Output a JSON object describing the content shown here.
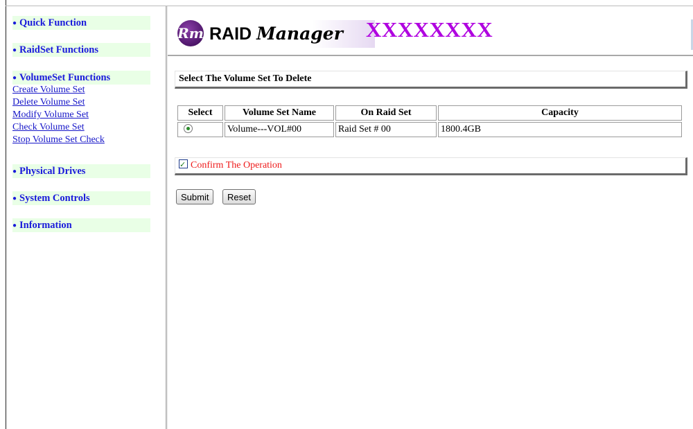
{
  "nav": {
    "sections": [
      {
        "label": "Quick Function"
      },
      {
        "label": "RaidSet Functions"
      },
      {
        "label": "VolumeSet Functions"
      },
      {
        "label": "Physical Drives"
      },
      {
        "label": "System Controls"
      },
      {
        "label": "Information"
      }
    ],
    "volumeset_links": [
      "Create Volume Set",
      "Delete Volume Set",
      "Modify Volume Set",
      "Check Volume Set",
      "Stop Volume Set Check"
    ]
  },
  "header": {
    "logo_mark": "Rm",
    "logo_word1": "RAID",
    "logo_word2": "Manager",
    "product_name": "XXXXXXXX"
  },
  "main": {
    "section_title": "Select The Volume Set To Delete",
    "table": {
      "columns": [
        "Select",
        "Volume Set Name",
        "On Raid Set",
        "Capacity"
      ],
      "rows": [
        {
          "selected": true,
          "name": "Volume---VOL#00",
          "raid_set": "Raid Set # 00",
          "capacity": "1800.4GB"
        }
      ]
    },
    "confirm_label": "Confirm The Operation",
    "confirm_checked": true,
    "submit_label": "Submit",
    "reset_label": "Reset"
  },
  "colors": {
    "nav_section_bg": "#e9ffe6",
    "nav_text": "#1a1adb",
    "product_name": "#b000e0",
    "confirm_text": "#ee1a1a"
  }
}
